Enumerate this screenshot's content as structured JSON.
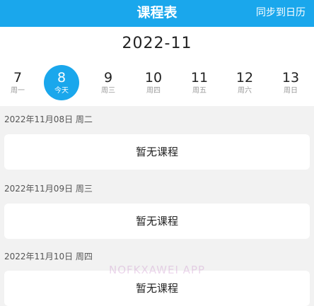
{
  "header": {
    "title": "课程表",
    "sync_label": "同步到日历"
  },
  "month": "2022-11",
  "week_days": [
    {
      "num": "7",
      "label": "周一"
    },
    {
      "num": "8",
      "label": "今天"
    },
    {
      "num": "9",
      "label": "周三"
    },
    {
      "num": "10",
      "label": "周四"
    },
    {
      "num": "11",
      "label": "周五"
    },
    {
      "num": "12",
      "label": "周六"
    },
    {
      "num": "13",
      "label": "周日"
    }
  ],
  "sections": [
    {
      "date": "2022年11月08日 周二",
      "content": "暂无课程"
    },
    {
      "date": "2022年11月09日 周三",
      "content": "暂无课程"
    },
    {
      "date": "2022年11月10日 周四",
      "content": "暂无课程"
    }
  ],
  "watermark": "NOFKXAWEI APP",
  "colors": {
    "accent": "#1aa7ec",
    "background": "#f2f2f2",
    "card": "#ffffff"
  }
}
